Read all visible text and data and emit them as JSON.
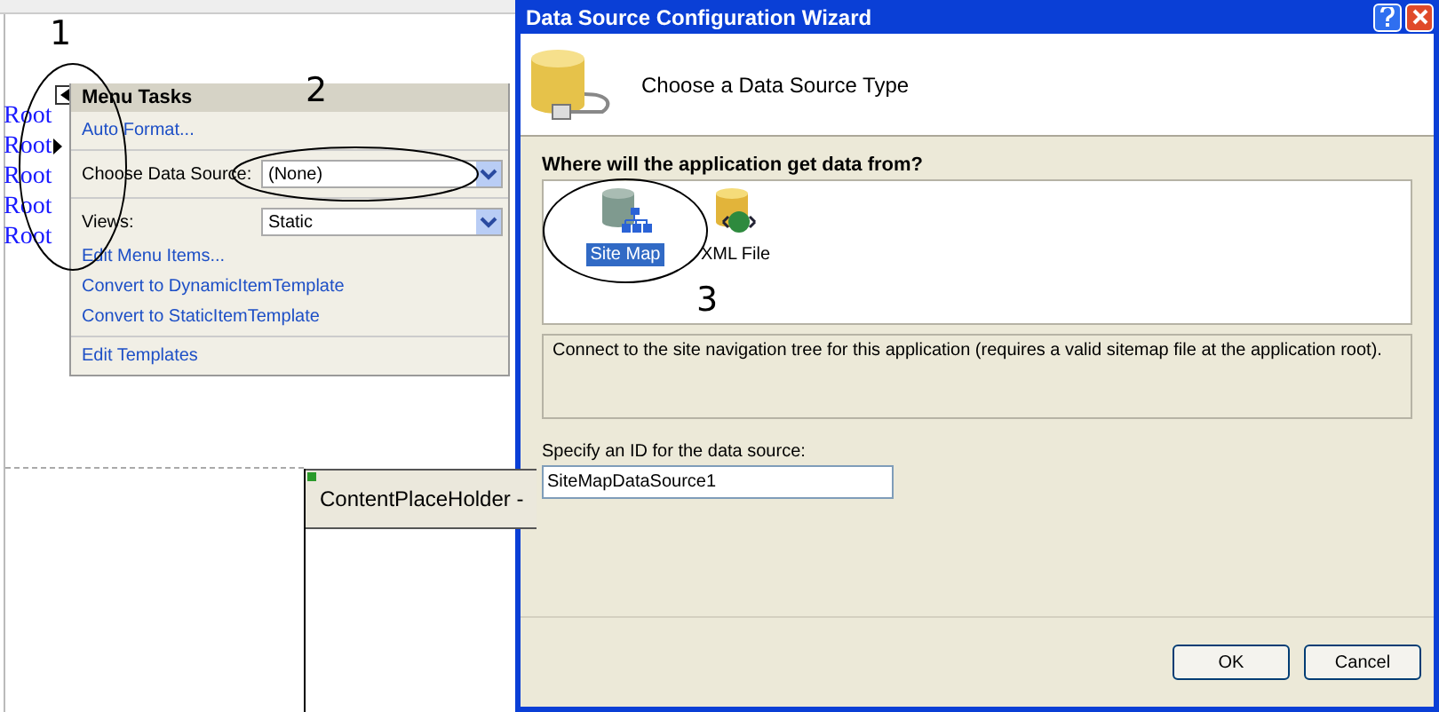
{
  "annotations": [
    {
      "text": "1"
    },
    {
      "text": "2"
    },
    {
      "text": "3"
    }
  ],
  "designer": {
    "menu_items": [
      {
        "label": "Root",
        "has_submenu": false
      },
      {
        "label": "Root",
        "has_submenu": true
      },
      {
        "label": "Root",
        "has_submenu": false
      },
      {
        "label": "Root",
        "has_submenu": false
      },
      {
        "label": "Root",
        "has_submenu": false
      }
    ],
    "tasks": {
      "title": "Menu Tasks",
      "sections": [
        [
          {
            "kind": "link",
            "label": "Auto Format..."
          }
        ],
        [
          {
            "kind": "dropdown",
            "label": "Choose Data Source:",
            "value": "(None)"
          }
        ],
        [
          {
            "kind": "dropdown",
            "label": "Views:",
            "value": "Static"
          },
          {
            "kind": "link",
            "label": "Edit Menu Items..."
          },
          {
            "kind": "link",
            "label": "Convert to DynamicItemTemplate"
          },
          {
            "kind": "link",
            "label": "Convert to StaticItemTemplate"
          }
        ],
        [
          {
            "kind": "link",
            "label": "Edit Templates"
          }
        ]
      ]
    },
    "placeholder": {
      "title": "ContentPlaceHolder -"
    }
  },
  "dialog": {
    "title": "Data Source Configuration Wizard",
    "heading": "Choose a Data Source Type",
    "question": "Where will the application get data from?",
    "types": [
      {
        "kind": "sitemap",
        "label": "Site Map",
        "selected": true
      },
      {
        "kind": "xml",
        "label": "XML File",
        "selected": false
      }
    ],
    "description": "Connect to the site navigation tree for this application (requires a valid sitemap file at the application root).",
    "id_label": "Specify an ID for the data source:",
    "id_value": "SiteMapDataSource1",
    "buttons": [
      "OK",
      "Cancel"
    ]
  }
}
